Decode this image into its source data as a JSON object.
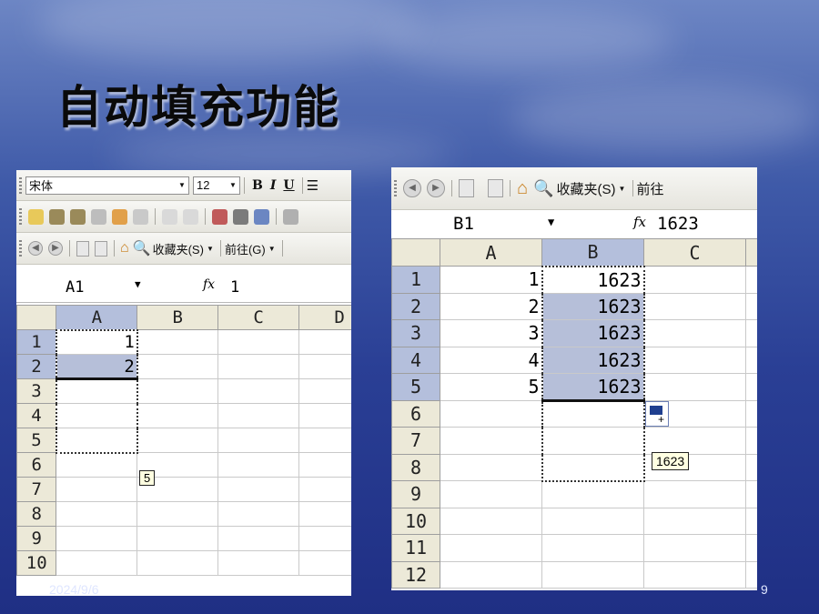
{
  "slide": {
    "title": "自动填充功能",
    "footer_date": "2024/9/6",
    "page_number": "9"
  },
  "left": {
    "font_name": "宋体",
    "font_size": "12",
    "format_buttons": [
      "B",
      "I",
      "U"
    ],
    "favorites_label": "收藏夹(S)",
    "go_label": "前往(G)",
    "name_box": "A1",
    "fx_label": "fx",
    "formula_value": "1",
    "columns": [
      "A",
      "B",
      "C",
      "D"
    ],
    "rows": [
      "1",
      "2",
      "3",
      "4",
      "5",
      "6",
      "7",
      "8",
      "9",
      "10"
    ],
    "cells_a": [
      "1",
      "2",
      "",
      "",
      "",
      "",
      "",
      "",
      "",
      ""
    ],
    "fill_tooltip": "5"
  },
  "right": {
    "favorites_label": "收藏夹(S)",
    "go_label": "前往",
    "name_box": "B1",
    "fx_label": "fx",
    "formula_value": "1623",
    "columns": [
      "A",
      "B",
      "C"
    ],
    "rows": [
      "1",
      "2",
      "3",
      "4",
      "5",
      "6",
      "7",
      "8",
      "9",
      "10",
      "11",
      "12"
    ],
    "cells_a": [
      "1",
      "2",
      "3",
      "4",
      "5",
      "",
      "",
      "",
      "",
      "",
      "",
      ""
    ],
    "cells_b": [
      "1623",
      "1623",
      "1623",
      "1623",
      "1623",
      "",
      "",
      "",
      "",
      "",
      "",
      ""
    ],
    "fill_tooltip": "1623"
  }
}
